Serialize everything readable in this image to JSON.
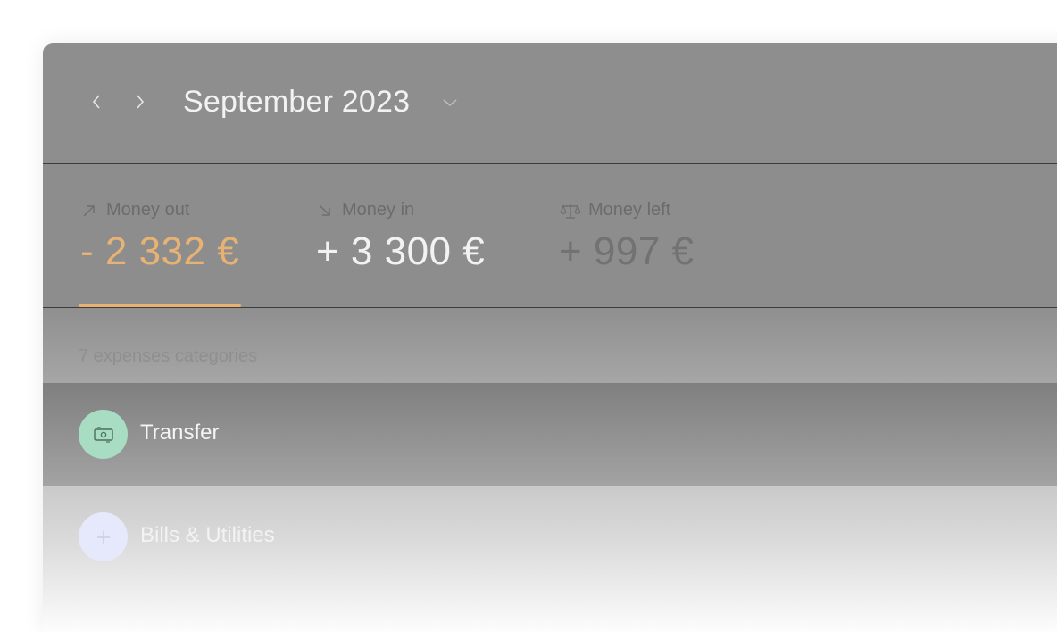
{
  "header": {
    "month_title": "September 2023"
  },
  "stats": {
    "money_out": {
      "label": "Money out",
      "value": "- 2 332 €",
      "color": "#e8b272",
      "icon": "arrow-up-right-icon"
    },
    "money_in": {
      "label": "Money in",
      "value": "+ 3 300 €",
      "color": "#f2f2f2",
      "icon": "arrow-down-right-icon"
    },
    "money_left": {
      "label": "Money left",
      "value": "+ 997 €",
      "color": "#707070",
      "icon": "scale-icon"
    }
  },
  "categories": {
    "caption": "7 expenses categories",
    "items": [
      {
        "label": "Transfer",
        "icon": "banknote-icon",
        "icon_bg": "#a8dcc3"
      },
      {
        "label": "Bills & Utilities",
        "icon": "plus-icon",
        "icon_bg": "#e6e9fb"
      }
    ]
  }
}
